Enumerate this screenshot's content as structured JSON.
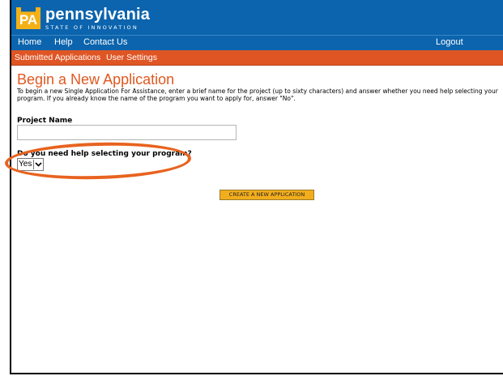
{
  "brand": {
    "logo_text": "PA",
    "name": "pennsylvania",
    "tagline": "STATE OF INNOVATION",
    "colors": {
      "header_blue": "#0b64ad",
      "accent_orange": "#df5524",
      "logo_gold": "#f3b117"
    }
  },
  "nav": {
    "home": "Home",
    "help": "Help",
    "contact": "Contact Us",
    "logout": "Logout"
  },
  "subnav": {
    "submitted": "Submitted Applications",
    "settings": "User Settings"
  },
  "main": {
    "title": "Begin a New Application",
    "intro": "To begin a new Single Application For Assistance, enter a brief name for the project (up to sixty characters) and answer whether you need help selecting your program. If you already know the name of the program you want to apply for, answer \"No\".",
    "project_label": "Project Name",
    "project_value": "",
    "help_question": "Do you need help selecting your program?",
    "help_selected": "Yes",
    "create_button": "CREATE A NEW APPLICATION"
  },
  "icons": {
    "dropdown": "chevron-down-icon"
  }
}
